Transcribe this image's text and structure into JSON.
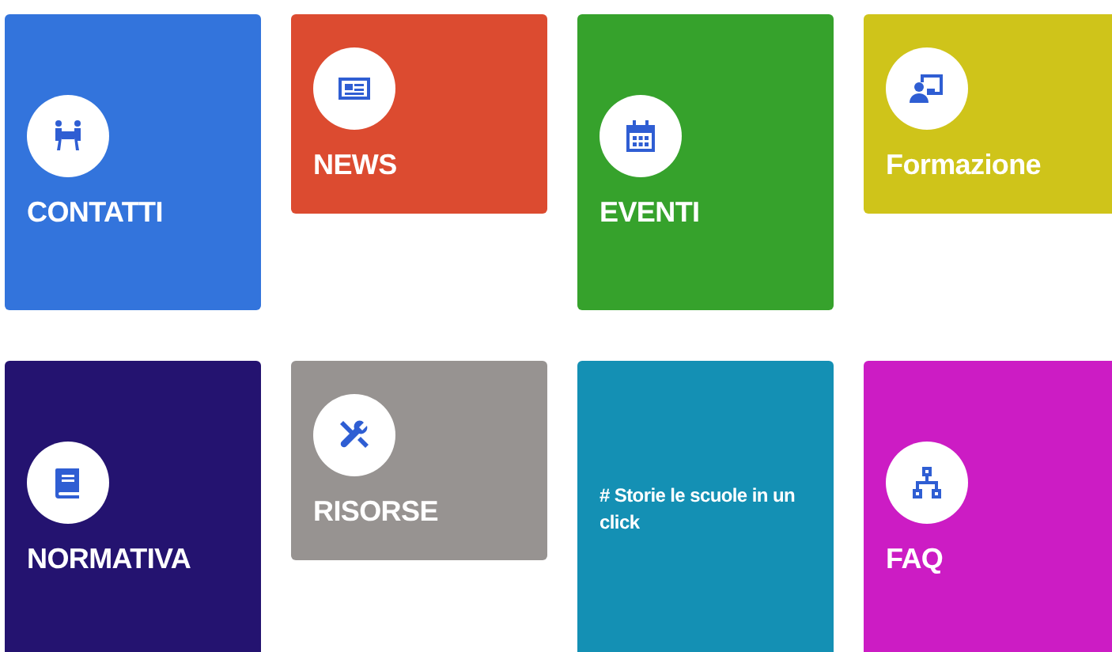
{
  "tiles": [
    {
      "label": "CONTATTI",
      "kind": "people",
      "tall": true,
      "color": "#3374dc"
    },
    {
      "label": "NEWS",
      "kind": "newspaper",
      "tall": false,
      "color": "#dc4b30"
    },
    {
      "label": "EVENTI",
      "kind": "calendar",
      "tall": true,
      "color": "#36a22c"
    },
    {
      "label": "Formazione",
      "kind": "teacher",
      "tall": false,
      "color": "#cfc41a"
    },
    {
      "label": "NORMATIVA",
      "kind": "book",
      "tall": true,
      "color": "#241370"
    },
    {
      "label": "RISORSE",
      "kind": "tools",
      "tall": false,
      "color": "#979391"
    },
    {
      "label": "# Storie le scuole in un click",
      "kind": "text",
      "tall": true,
      "color": "#1490b4"
    },
    {
      "label": "FAQ",
      "kind": "network",
      "tall": true,
      "color": "#cc1cc4"
    }
  ]
}
